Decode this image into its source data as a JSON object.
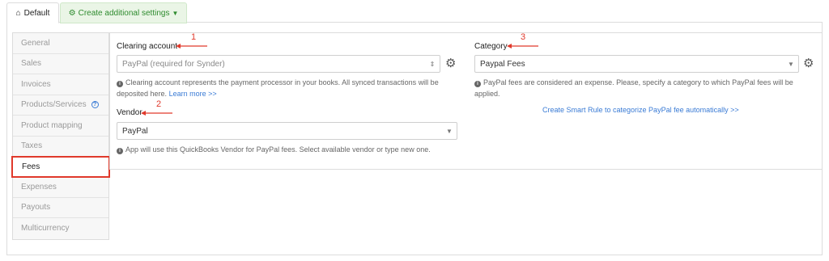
{
  "tabs": {
    "default_label": "Default",
    "create_label": "Create additional settings",
    "default_icon": "home-icon",
    "create_icon": "gear-icon",
    "create_caret": "caret-down-icon"
  },
  "sidebar": {
    "items": [
      {
        "label": "General"
      },
      {
        "label": "Sales"
      },
      {
        "label": "Invoices"
      },
      {
        "label": "Products/Services"
      },
      {
        "label": "Product mapping"
      },
      {
        "label": "Taxes"
      },
      {
        "label": "Fees"
      },
      {
        "label": "Expenses"
      },
      {
        "label": "Payouts"
      },
      {
        "label": "Multicurrency"
      }
    ],
    "active": "Fees",
    "help_glyph": "?"
  },
  "clearing": {
    "label": "Clearing account",
    "value": "PayPal (required for Synder)",
    "help_text": "Clearing account represents the payment processor in your books. All synced transactions will be deposited here.",
    "learn_more": "Learn more >>"
  },
  "vendor": {
    "label": "Vendor",
    "value": "PayPal",
    "help_text": "App will use this QuickBooks Vendor for PayPal fees. Select available vendor or type new one."
  },
  "category": {
    "label": "Category",
    "value": "Paypal Fees",
    "help_text": "PayPal fees are considered an expense. Please, specify a category to which PayPal fees will be applied.",
    "rule_link": "Create Smart Rule to categorize PayPal fee automatically >>"
  },
  "annotations": {
    "n1": "1",
    "n2": "2",
    "n3": "3",
    "color": "#e0392b"
  },
  "colors": {
    "accent_green": "#2e8b2e",
    "link_blue": "#3a7bd5",
    "highlight_red": "#e0392b"
  }
}
